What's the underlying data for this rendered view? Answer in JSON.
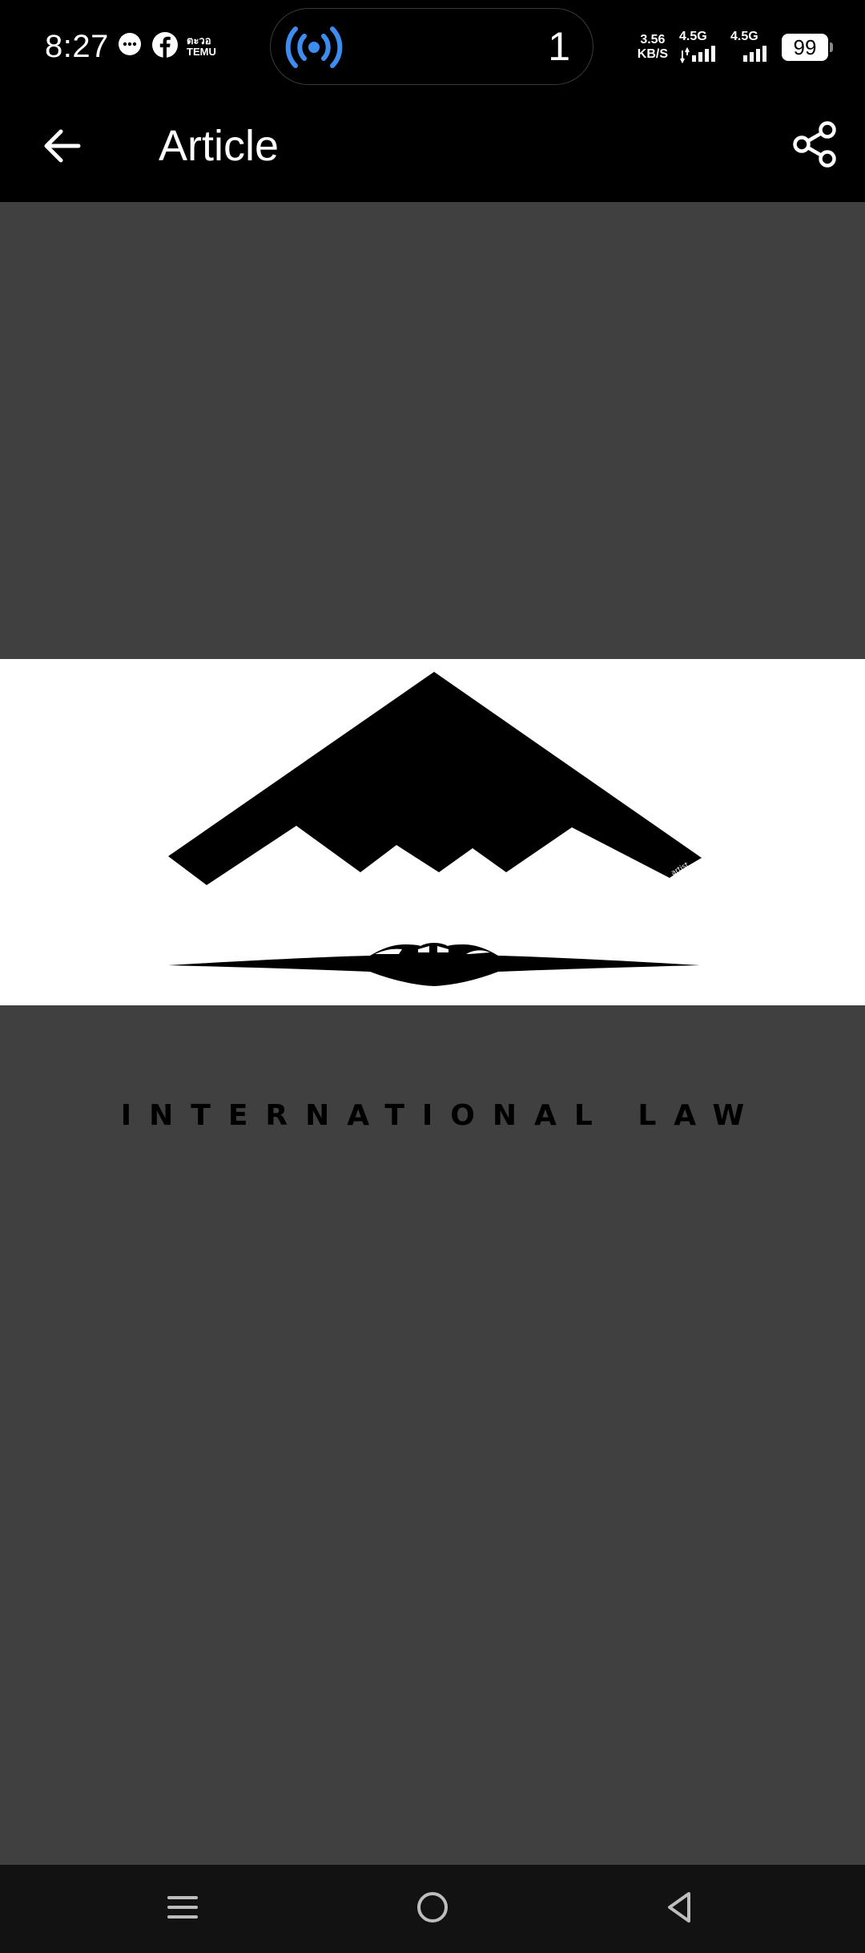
{
  "status_bar": {
    "time": "8:27",
    "temu_line1": "ตะวอ",
    "temu_line2": "TEMU",
    "hotspot_count": "1",
    "net_speed_value": "3.56",
    "net_speed_unit": "KB/S",
    "sim1_label": "4.5G",
    "sim2_label": "4.5G",
    "battery_level": "99",
    "icons": [
      "message-bubble-icon",
      "facebook-icon",
      "temu-icon",
      "hotspot-broadcast-icon",
      "signal-icon",
      "battery-icon"
    ]
  },
  "app_bar": {
    "title": "Article",
    "back_icon": "arrow-left-icon",
    "share_icon": "share-icon"
  },
  "article_image": {
    "caption": "INTERNATIONAL LAW",
    "description_icon": "stealth-bomber-icon"
  },
  "nav_bar": {
    "icons": [
      "recents-menu-icon",
      "home-circle-icon",
      "back-triangle-icon"
    ]
  },
  "colors": {
    "bar_bg": "#000000",
    "content_bg": "#404040",
    "hotspot_blue": "#3d8cf0",
    "nav_bg": "#121212"
  }
}
